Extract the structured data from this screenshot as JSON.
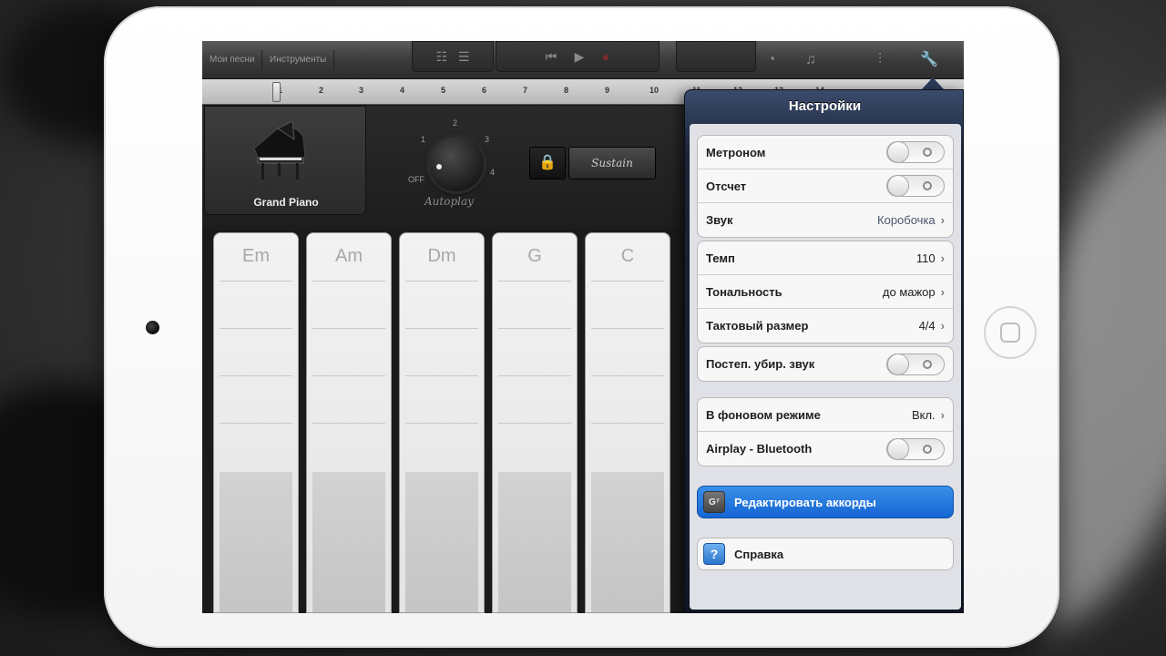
{
  "toolbar": {
    "my_songs": "Мои песни",
    "instruments": "Инструменты"
  },
  "ruler": {
    "ticks": [
      "1",
      "2",
      "3",
      "4",
      "5",
      "6",
      "7",
      "8",
      "9",
      "10",
      "11",
      "12",
      "13",
      "14"
    ]
  },
  "instrument": {
    "name": "Grand Piano"
  },
  "autoplay": {
    "label": "Autoplay",
    "off": "OFF",
    "positions": [
      "1",
      "2",
      "3",
      "4"
    ]
  },
  "sustain": {
    "label": "Sustain"
  },
  "chords": [
    "Em",
    "Am",
    "Dm",
    "G",
    "C"
  ],
  "settings": {
    "title": "Настройки",
    "groups": [
      {
        "rows": [
          {
            "label": "Метроном",
            "type": "toggle",
            "on": false
          },
          {
            "label": "Отсчет",
            "type": "toggle",
            "on": false
          },
          {
            "label": "Звук",
            "type": "disclosure",
            "value": "Коробочка"
          }
        ]
      },
      {
        "rows": [
          {
            "label": "Темп",
            "type": "disclosure",
            "value": "110"
          },
          {
            "label": "Тональность",
            "type": "disclosure",
            "value": "до мажор"
          },
          {
            "label": "Тактовый размер",
            "type": "disclosure",
            "value": "4/4"
          }
        ]
      },
      {
        "rows": [
          {
            "label": "Постеп. убир. звук",
            "type": "toggle",
            "on": false
          }
        ]
      },
      {
        "rows": [
          {
            "label": "В фоновом режиме",
            "type": "disclosure",
            "value": "Вкл."
          },
          {
            "label": "Airplay - Bluetooth",
            "type": "toggle",
            "on": false
          }
        ]
      }
    ],
    "edit_chords": {
      "icon": "G⁷",
      "label": "Редактировать аккорды"
    },
    "help": {
      "icon": "?",
      "label": "Справка"
    }
  },
  "colors": {
    "accent_blue": "#1565d4",
    "popover_header": "#2b3b5a"
  }
}
